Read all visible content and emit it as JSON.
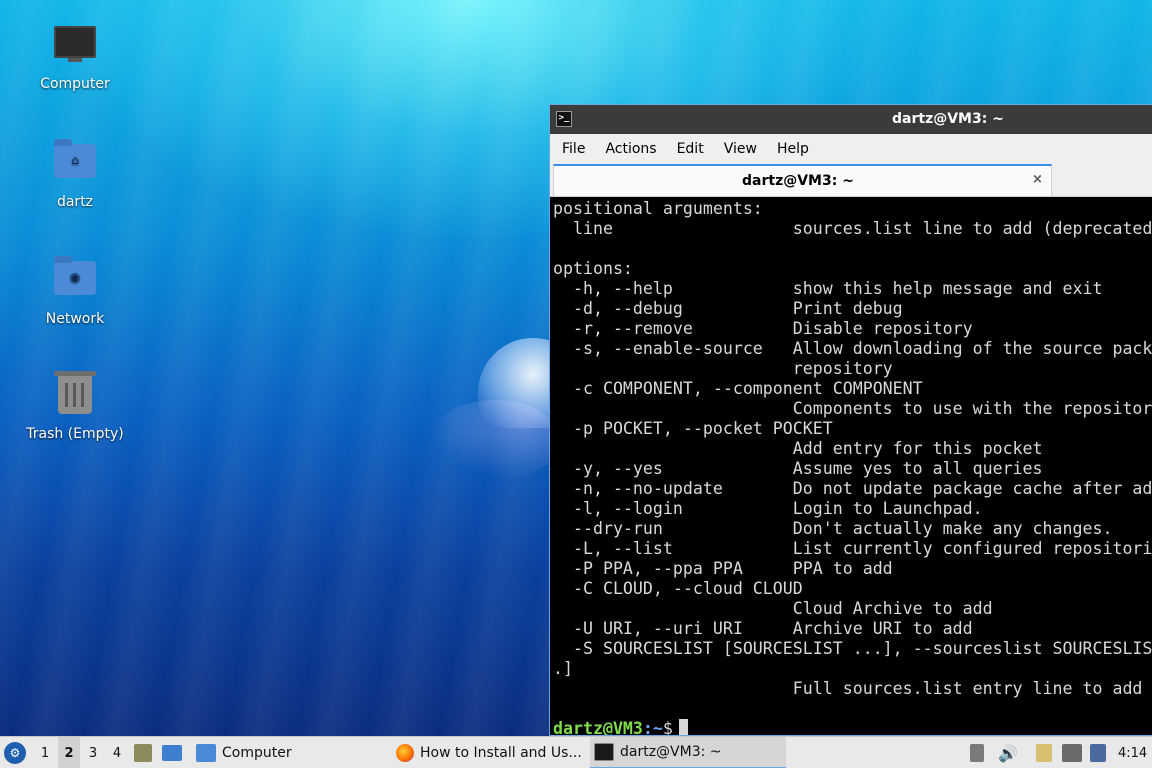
{
  "desktop": {
    "icons": [
      {
        "label": "Computer"
      },
      {
        "label": "dartz"
      },
      {
        "label": "Network"
      },
      {
        "label": "Trash (Empty)"
      }
    ]
  },
  "terminal": {
    "window_title": "dartz@VM3: ~",
    "menu": [
      "File",
      "Actions",
      "Edit",
      "View",
      "Help"
    ],
    "tab_label": "dartz@VM3: ~",
    "tab_close": "×",
    "lines": [
      "positional arguments:",
      "  line                  sources.list line to add (deprecated)",
      "",
      "options:",
      "  -h, --help            show this help message and exit",
      "  -d, --debug           Print debug",
      "  -r, --remove          Disable repository",
      "  -s, --enable-source   Allow downloading of the source packages from the",
      "                        repository",
      "  -c COMPONENT, --component COMPONENT",
      "                        Components to use with the repository",
      "  -p POCKET, --pocket POCKET",
      "                        Add entry for this pocket",
      "  -y, --yes             Assume yes to all queries",
      "  -n, --no-update       Do not update package cache after adding",
      "  -l, --login           Login to Launchpad.",
      "  --dry-run             Don't actually make any changes.",
      "  -L, --list            List currently configured repositories",
      "  -P PPA, --ppa PPA     PPA to add",
      "  -C CLOUD, --cloud CLOUD",
      "                        Cloud Archive to add",
      "  -U URI, --uri URI     Archive URI to add",
      "  -S SOURCESLIST [SOURCESLIST ...], --sourceslist SOURCESLIST [SOURCESLIST ..",
      ".]",
      "                        Full sources.list entry line to add"
    ],
    "prompt_user": "dartz@VM3",
    "prompt_path": ":~",
    "prompt_symbol": "$"
  },
  "taskbar": {
    "start_icon": "lubuntu-logo-icon",
    "workspaces": [
      "1",
      "2",
      "3",
      "4"
    ],
    "active_workspace": "2",
    "tasks": [
      {
        "label": "Computer",
        "icon": "folder-icon"
      },
      {
        "label": "How to Install and Us...",
        "icon": "firefox-icon"
      },
      {
        "label": "dartz@VM3: ~",
        "icon": "terminal-icon"
      }
    ],
    "clock": "4:14"
  },
  "colors": {
    "prompt_user": "#7fdc4a",
    "prompt_path": "#6aa6ff",
    "accent": "#3a8ee6"
  }
}
